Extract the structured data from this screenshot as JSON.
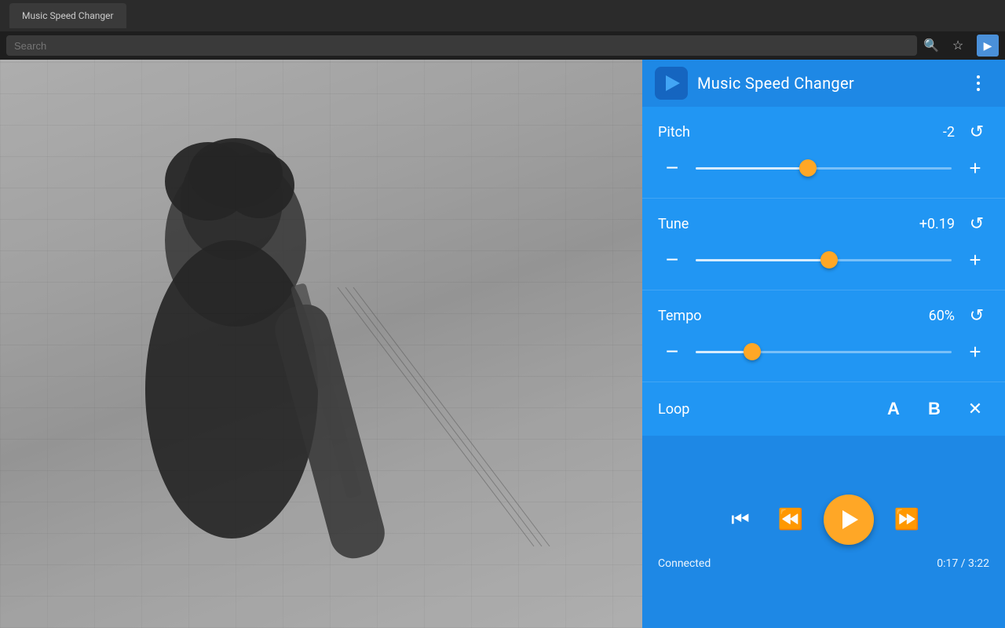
{
  "browser": {
    "toolbar_star_label": "☆",
    "toolbar_extension_label": "▶"
  },
  "app": {
    "title": "Music Speed Changer",
    "logo_aria": "Music Speed Changer logo",
    "menu_aria": "More options"
  },
  "pitch": {
    "label": "Pitch",
    "value": "-2",
    "thumb_percent": 44,
    "reset_aria": "Reset pitch"
  },
  "tune": {
    "label": "Tune",
    "value": "+0.19",
    "thumb_percent": 52,
    "reset_aria": "Reset tune"
  },
  "tempo": {
    "label": "Tempo",
    "value": "60%",
    "thumb_percent": 22,
    "reset_aria": "Reset tempo"
  },
  "loop": {
    "label": "Loop",
    "a_label": "A",
    "b_label": "B",
    "close_aria": "Close loop"
  },
  "playback": {
    "skip_back_aria": "Skip to beginning",
    "rewind_aria": "Rewind",
    "play_aria": "Play",
    "forward_aria": "Fast forward",
    "status": "Connected",
    "time": "0:17 / 3:22"
  },
  "search": {
    "placeholder": "Search"
  },
  "colors": {
    "panel_bg": "#2196f3",
    "panel_header": "#1e88e5",
    "thumb_color": "#ffa726",
    "play_btn_color": "#ffa726"
  }
}
